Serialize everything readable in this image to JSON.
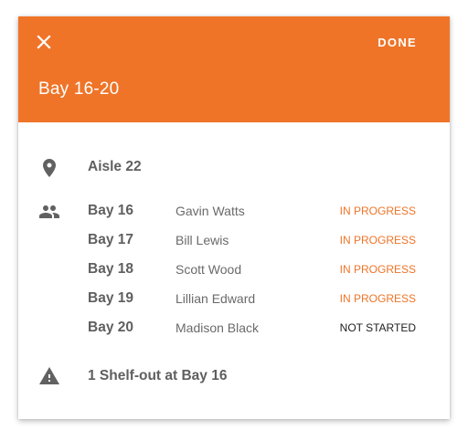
{
  "header": {
    "title": "Bay 16-20",
    "done_label": "DONE",
    "close_icon": "close-icon",
    "color": "#ef7428"
  },
  "location": {
    "icon": "map-pin-icon",
    "label": "Aisle 22"
  },
  "assignments": {
    "icon": "people-icon",
    "rows": [
      {
        "bay": "Bay 16",
        "person": "Gavin Watts",
        "status": "IN PROGRESS"
      },
      {
        "bay": "Bay 17",
        "person": "Bill Lewis",
        "status": "IN PROGRESS"
      },
      {
        "bay": "Bay 18",
        "person": "Scott Wood",
        "status": "IN PROGRESS"
      },
      {
        "bay": "Bay 19",
        "person": "Lillian Edward",
        "status": "IN PROGRESS"
      },
      {
        "bay": "Bay 20",
        "person": "Madison Black",
        "status": "NOT STARTED"
      }
    ]
  },
  "alert": {
    "icon": "warning-icon",
    "label": "1 Shelf-out at Bay 16"
  },
  "colors": {
    "accent": "#ef7428",
    "status_in_progress": "#ef7428",
    "status_not_started": "#212121"
  }
}
